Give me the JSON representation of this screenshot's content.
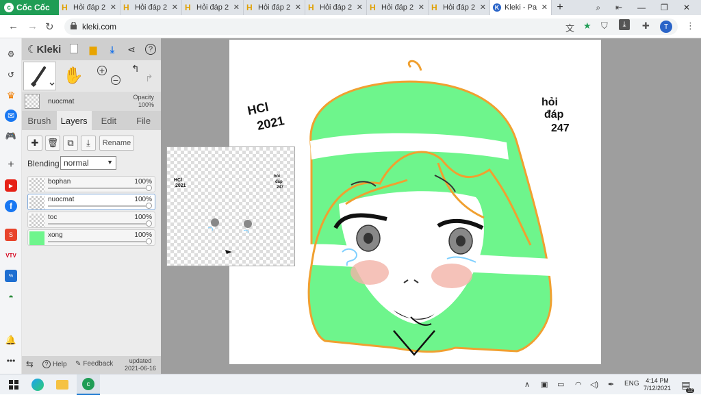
{
  "browser": {
    "brand": "Cốc Cốc",
    "tabs": [
      {
        "label": "Hỏi đáp 2"
      },
      {
        "label": "Hỏi đáp 2"
      },
      {
        "label": "Hỏi đáp 2"
      },
      {
        "label": "Hỏi đáp 2"
      },
      {
        "label": "Hỏi đáp 2"
      },
      {
        "label": "Hỏi đáp 2"
      },
      {
        "label": "Hỏi đáp 2"
      },
      {
        "label": "Kleki - Pa",
        "active": true
      }
    ],
    "url": "kleki.com",
    "profile_initial": "T"
  },
  "kleki": {
    "logo": "Kleki",
    "current_layer": "nuocmat",
    "opacity_label": "Opacity",
    "opacity_value": "100%",
    "tabs": [
      "Brush",
      "Layers",
      "Edit",
      "File"
    ],
    "active_tab": "Layers",
    "rename_label": "Rename",
    "blending_label": "Blending",
    "blending_value": "normal",
    "layers": [
      {
        "name": "bophan",
        "opacity": "100%"
      },
      {
        "name": "nuocmat",
        "opacity": "100%",
        "selected": true
      },
      {
        "name": "toc",
        "opacity": "100%"
      },
      {
        "name": "xong",
        "opacity": "100%"
      }
    ],
    "footer": {
      "help": "Help",
      "feedback": "Feedback",
      "updated_label": "updated",
      "updated_date": "2021-06-16"
    }
  },
  "artwork": {
    "text_left_1": "HCl",
    "text_left_2": "2021",
    "text_right_1": "hỏi",
    "text_right_2": "đáp",
    "text_right_3": "247",
    "hair_color": "#6ef58c",
    "outline_color": "#f0a030"
  },
  "taskbar": {
    "lang": "ENG",
    "time": "4:14 PM",
    "date": "7/12/2021",
    "notif_count": "12"
  }
}
